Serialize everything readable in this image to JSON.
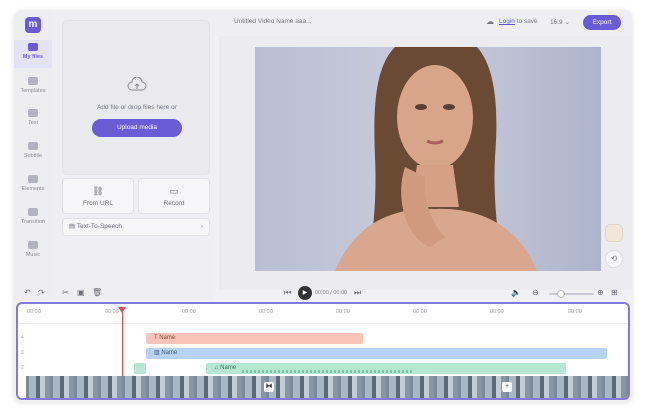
{
  "app": {
    "title": "Untitled Video Name aaa...",
    "login_link": "Login",
    "login_suffix": "to save",
    "aspect_ratio": "16:9",
    "export_label": "Export"
  },
  "sidebar": {
    "items": [
      {
        "label": "My files",
        "icon": "folder-icon",
        "active": true
      },
      {
        "label": "Templates",
        "icon": "templates-icon"
      },
      {
        "label": "Text",
        "icon": "text-icon"
      },
      {
        "label": "Subtitle",
        "icon": "subtitle-icon"
      },
      {
        "label": "Elements",
        "icon": "elements-icon"
      },
      {
        "label": "Transition",
        "icon": "transition-icon"
      },
      {
        "label": "Music",
        "icon": "music-icon"
      }
    ]
  },
  "panel": {
    "drop_text": "Add file or drop files here or",
    "upload_label": "Upload media",
    "from_url_label": "From URL",
    "record_label": "Record",
    "tts_label": "Text-To-Speech"
  },
  "playback": {
    "timecode": "00:00 / 00:00"
  },
  "timeline": {
    "ticks": [
      "00:00",
      "00:00",
      "00:00",
      "00:00",
      "00:00",
      "00:00",
      "00:00",
      "00:00"
    ],
    "rows": [
      "4",
      "3",
      "2"
    ],
    "clips": {
      "text": "Name",
      "image": "Name",
      "audio": "Name"
    }
  },
  "colors": {
    "accent": "#6a5bd6",
    "timeline_border": "#8179e0",
    "text_clip": "#f8c3b8",
    "image_clip": "#b6d2f5",
    "audio_clip": "#b6e6d4",
    "playhead": "#e04e4e"
  }
}
